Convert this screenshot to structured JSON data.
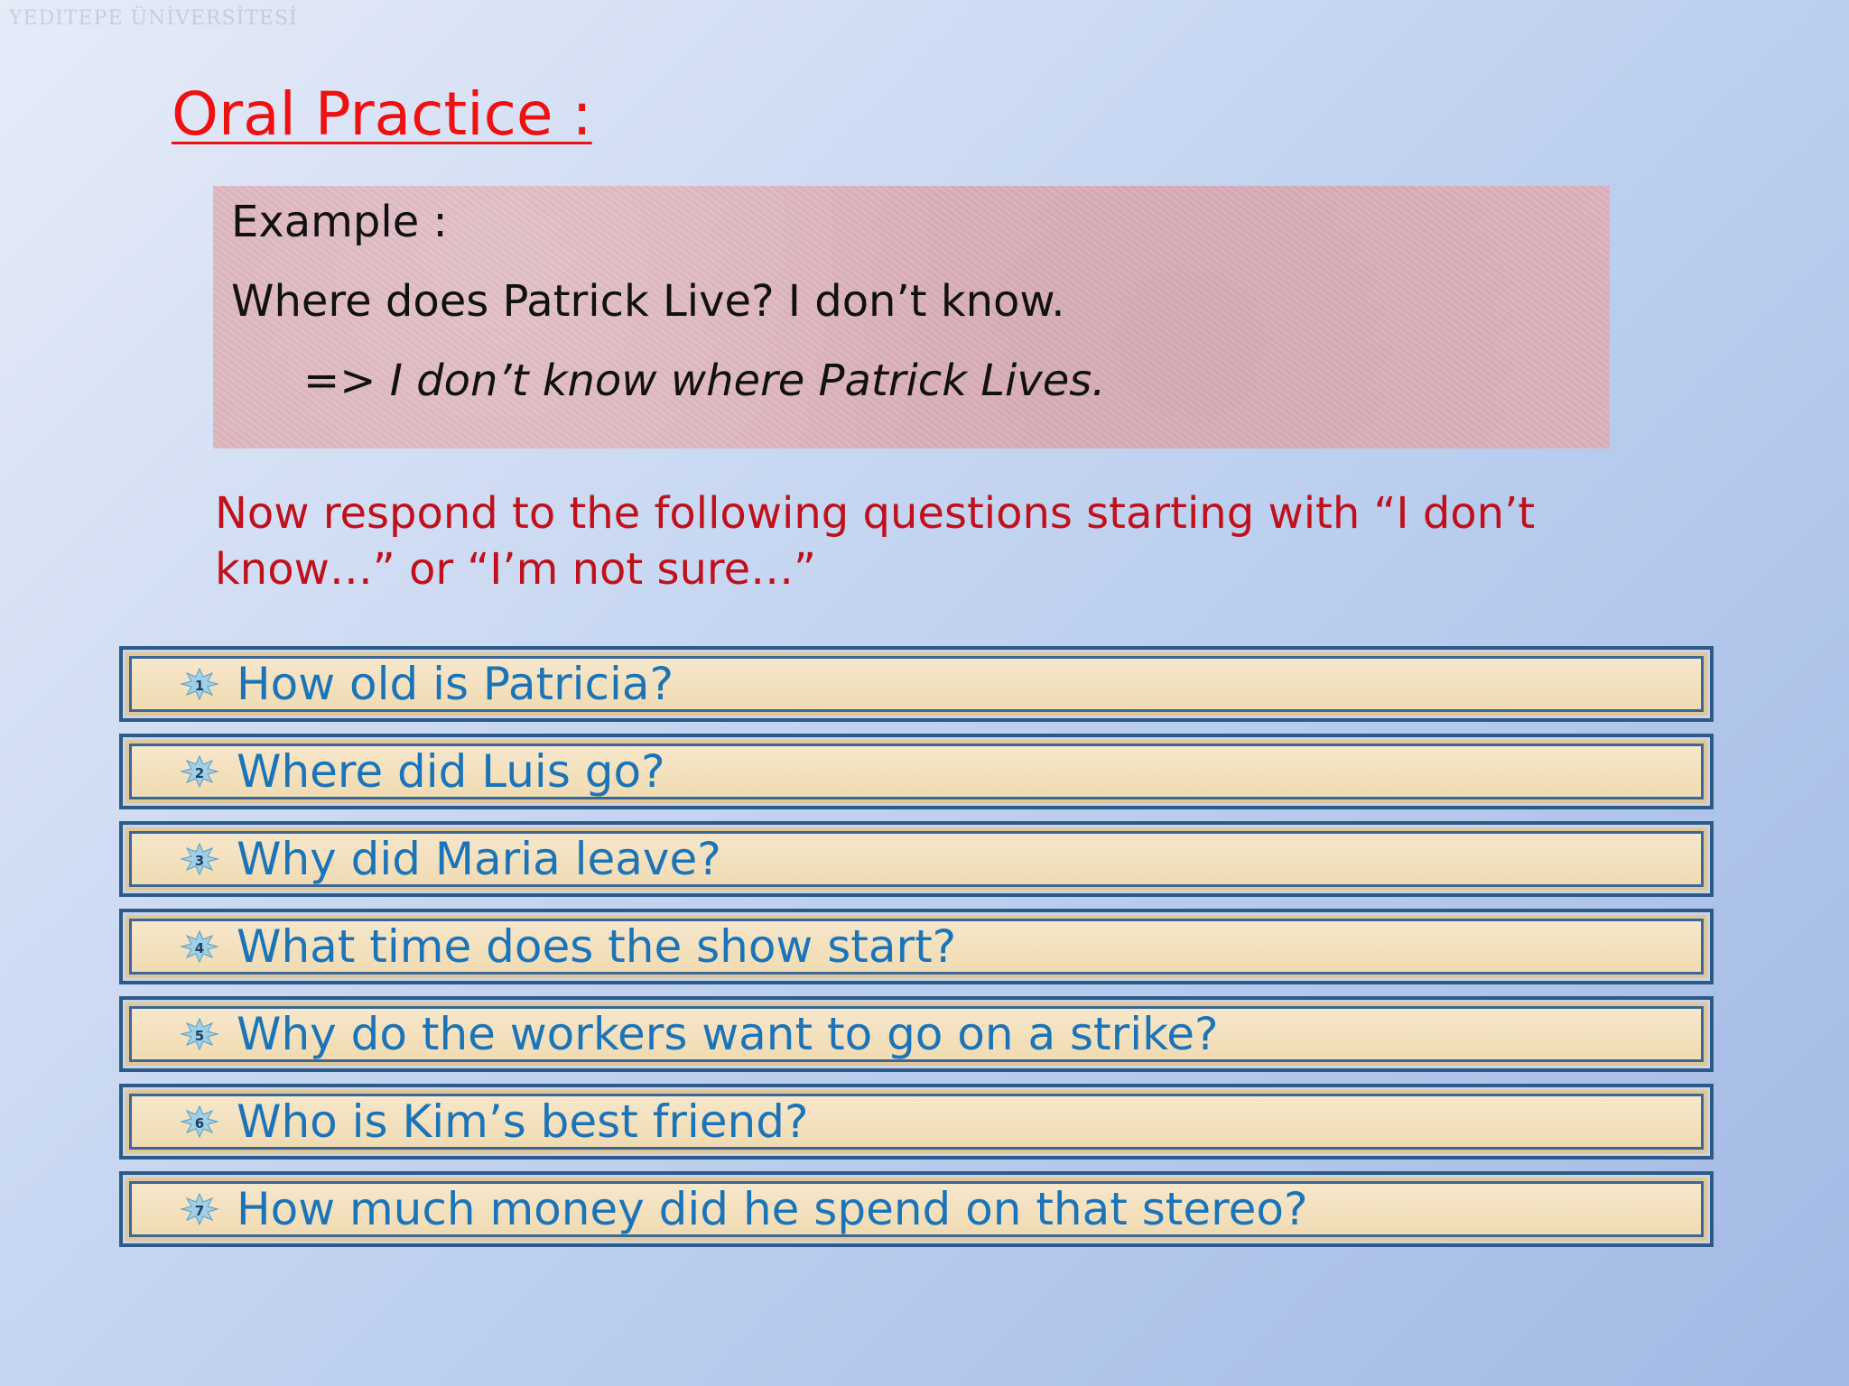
{
  "logo": {
    "text": "YEDITEPE ÜNİVERSİTESİ"
  },
  "title": "Oral Practice :",
  "example": {
    "label": "Example :",
    "question": "Where does Patrick Live? I don’t know.",
    "arrow": "=>",
    "answer": "I don’t know where Patrick Lives."
  },
  "instruction": "Now respond to the following questions starting with “I don’t know…” or “I’m not sure…”",
  "questions": [
    {
      "number": "1",
      "text": "How old is Patricia?"
    },
    {
      "number": "2",
      "text": "Where did Luis go?"
    },
    {
      "number": "3",
      "text": "Why did Maria leave?"
    },
    {
      "number": "4",
      "text": "What time does the show start?"
    },
    {
      "number": "5",
      "text": "Why do the workers want to go on a strike?"
    },
    {
      "number": "6",
      "text": "Who is Kim’s best friend?"
    },
    {
      "number": "7",
      "text": "How much money did he spend on that stereo?"
    }
  ],
  "colors": {
    "title": "#ee1111",
    "instruction": "#c0101c",
    "question_text": "#1b74b8",
    "box_border": "#2e5a88",
    "example_bg": "#dcb3bd"
  },
  "icons": {
    "bullet": "numbered-starburst-icon",
    "logo": "university-logo-icon"
  }
}
